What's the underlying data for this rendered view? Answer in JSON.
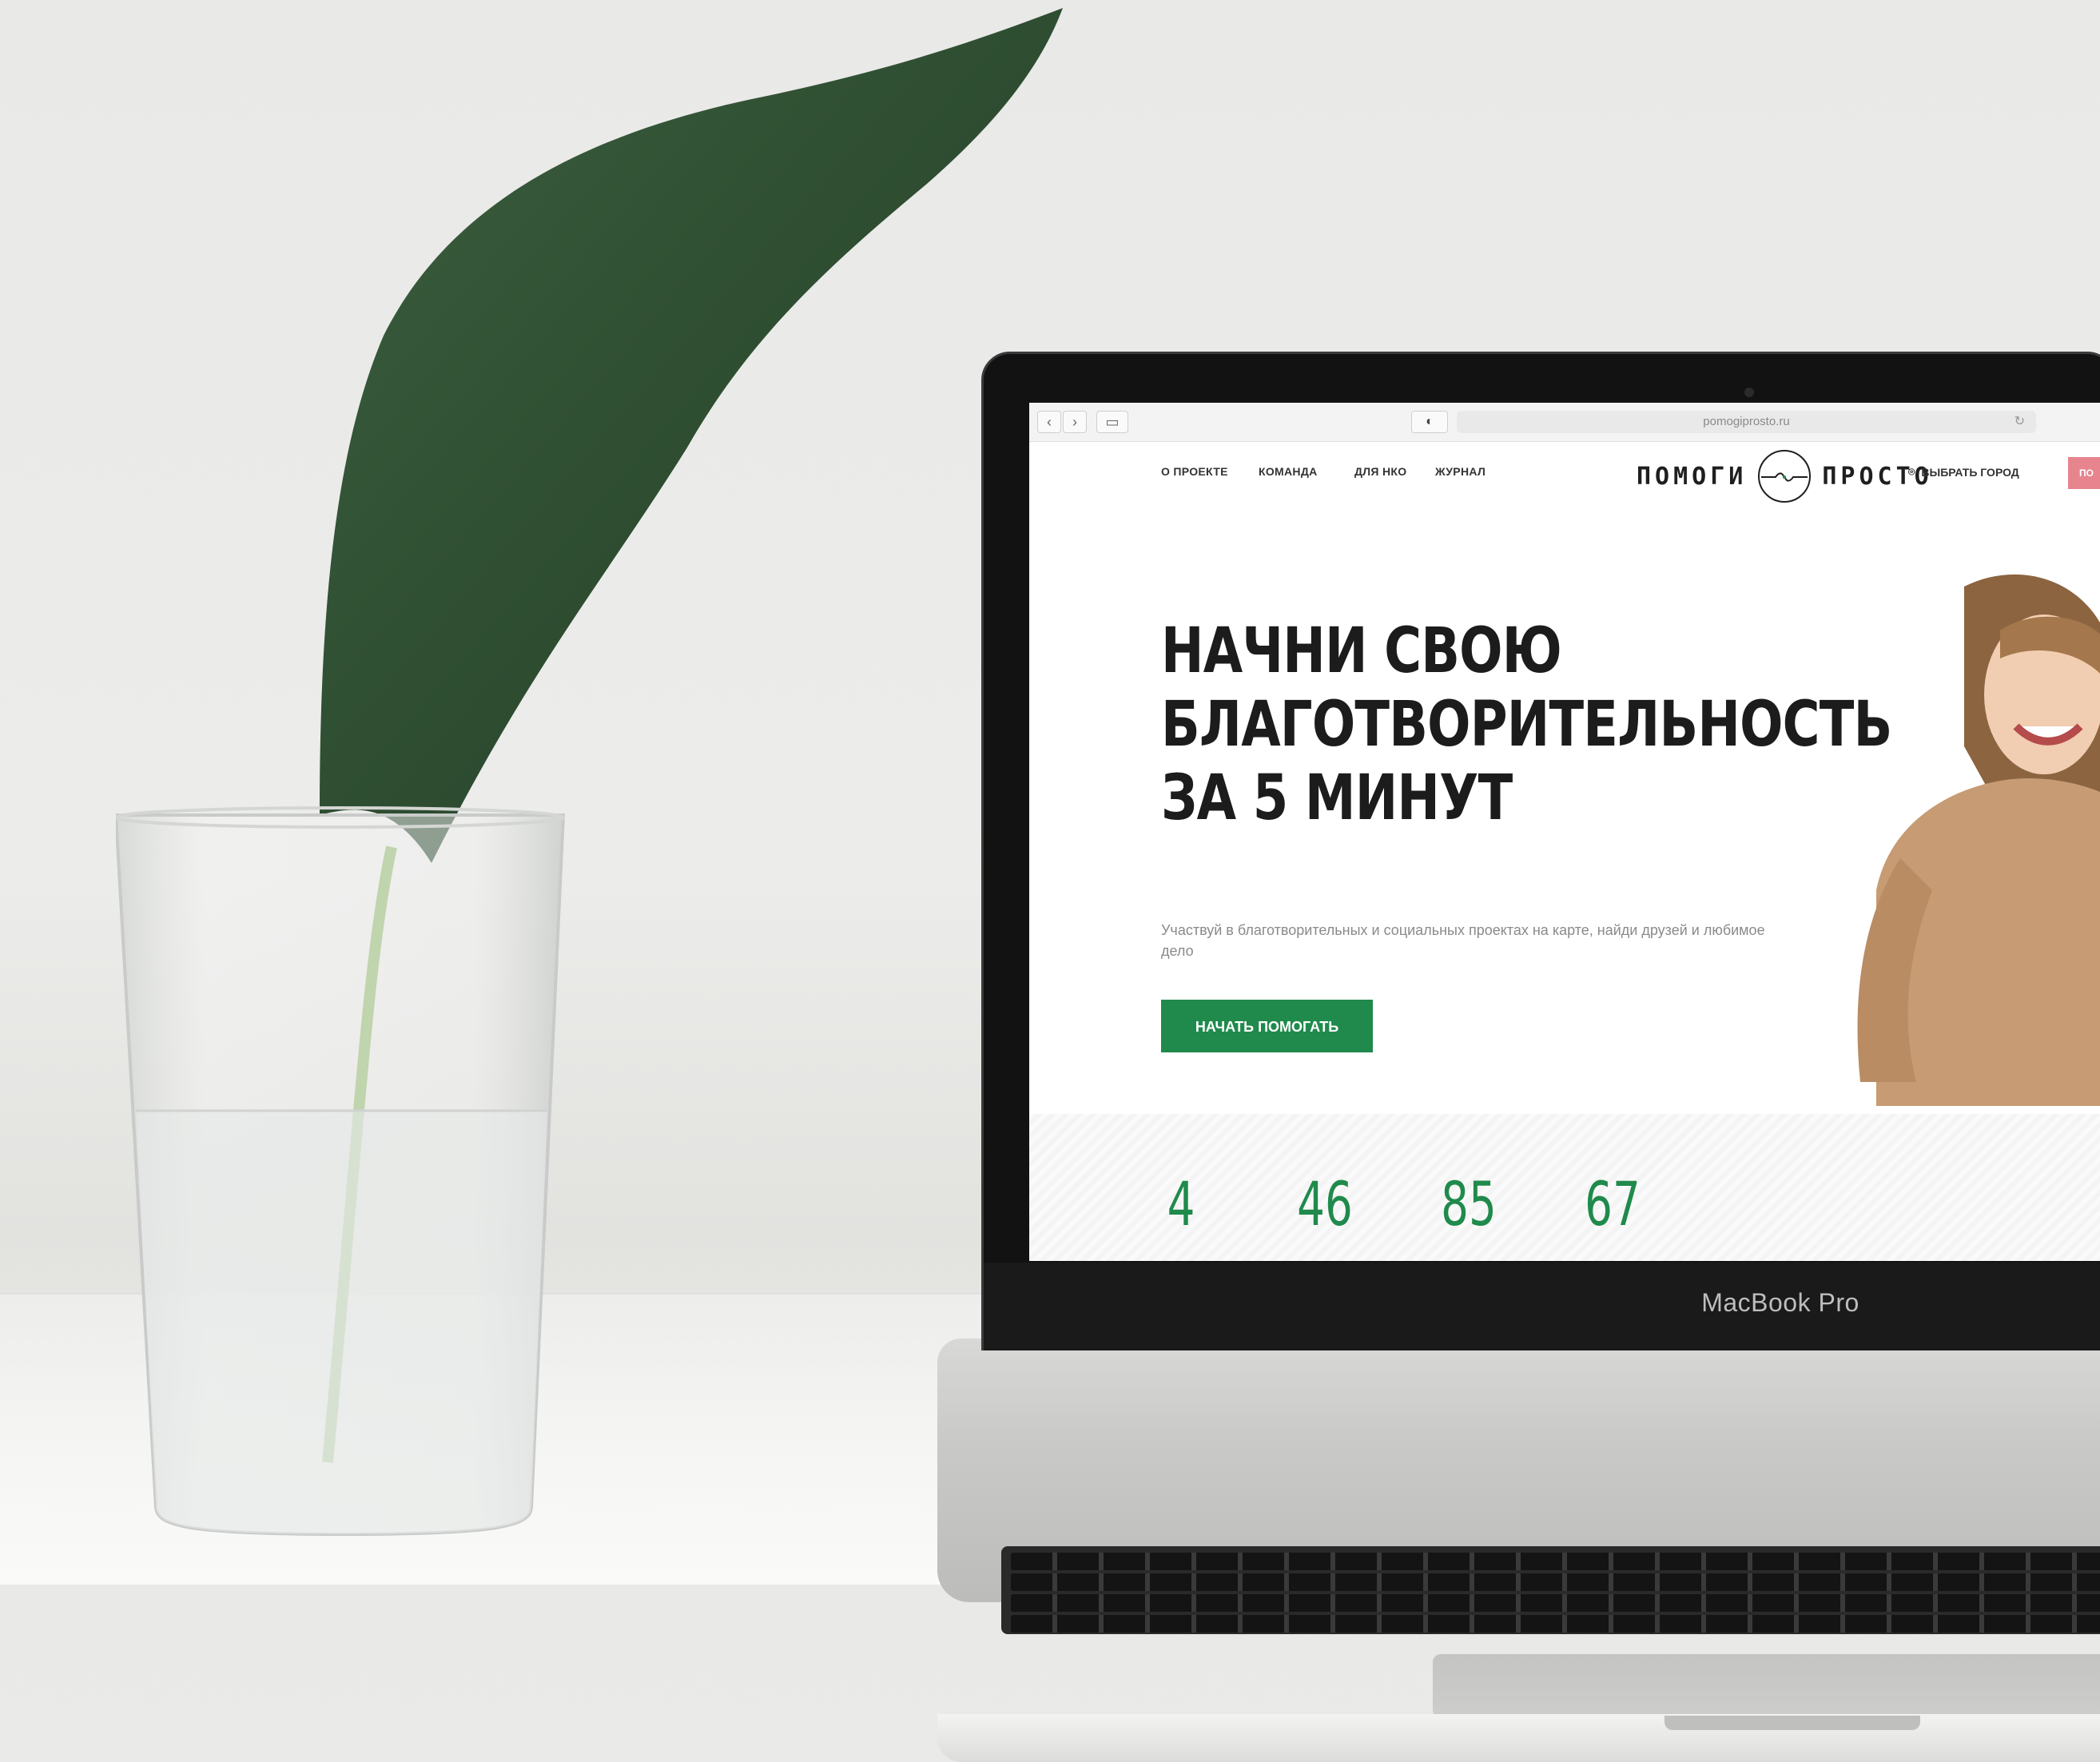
{
  "browser": {
    "back_icon": "chevron-left-icon",
    "forward_icon": "chevron-right-icon",
    "sidebar_icon": "sidebar-icon",
    "shield_icon": "shield-icon",
    "url": "pomogiprosto.ru",
    "reload_icon": "reload-icon"
  },
  "header": {
    "nav": [
      "О ПРОЕКТЕ",
      "КОМАНДА",
      "ДЛЯ НКО",
      "ЖУРНАЛ"
    ],
    "logo_left": "ПОМОГИ",
    "logo_right": "ПРОСТО",
    "city_label": "ВЫБРАТЬ ГОРОД",
    "city_icon": "location-pin-icon",
    "cta_label": "ПО"
  },
  "hero": {
    "title_lines": [
      "НАЧНИ СВОЮ",
      "БЛАГОТВОРИТЕЛЬНОСТЬ",
      "ЗА 5 МИНУТ"
    ],
    "subtitle": "Участвуй в благотворительных и социальных проектах на карте, найди друзей и любимое дело",
    "button_label": "НАЧАТЬ ПОМОГАТЬ"
  },
  "stats": [
    "4",
    "46",
    "85",
    "67"
  ],
  "device": {
    "brand": "MacBook Pro"
  },
  "colors": {
    "accent_green": "#1f8a4c",
    "accent_pink": "#e7848e"
  }
}
